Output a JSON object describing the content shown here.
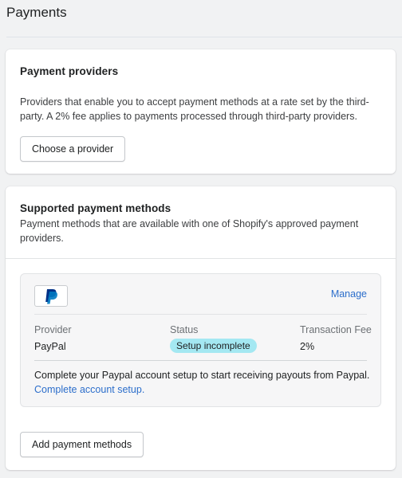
{
  "page": {
    "title": "Payments"
  },
  "providers_card": {
    "title": "Payment providers",
    "description": "Providers that enable you to accept payment methods at a rate set by the third-party. A 2% fee applies to payments processed through third-party providers.",
    "button_label": "Choose a provider"
  },
  "methods_card": {
    "title": "Supported payment methods",
    "description": "Payment methods that are available with one of Shopify's approved payment providers.",
    "provider": {
      "logo_icon": "paypal-icon",
      "manage_label": "Manage",
      "columns": {
        "provider_label": "Provider",
        "status_label": "Status",
        "fee_label": "Transaction Fee"
      },
      "values": {
        "provider": "PayPal",
        "status": "Setup incomplete",
        "fee": "2%"
      },
      "setup_message": "Complete your Paypal account setup to start receiving payouts from Paypal.",
      "setup_link": "Complete account setup",
      "setup_link_suffix": "."
    },
    "button_label": "Add payment methods"
  },
  "colors": {
    "link": "#2c6ecb",
    "status_badge": "#a4e8f2",
    "paypal_dark": "#003087",
    "paypal_light": "#0079c1"
  }
}
